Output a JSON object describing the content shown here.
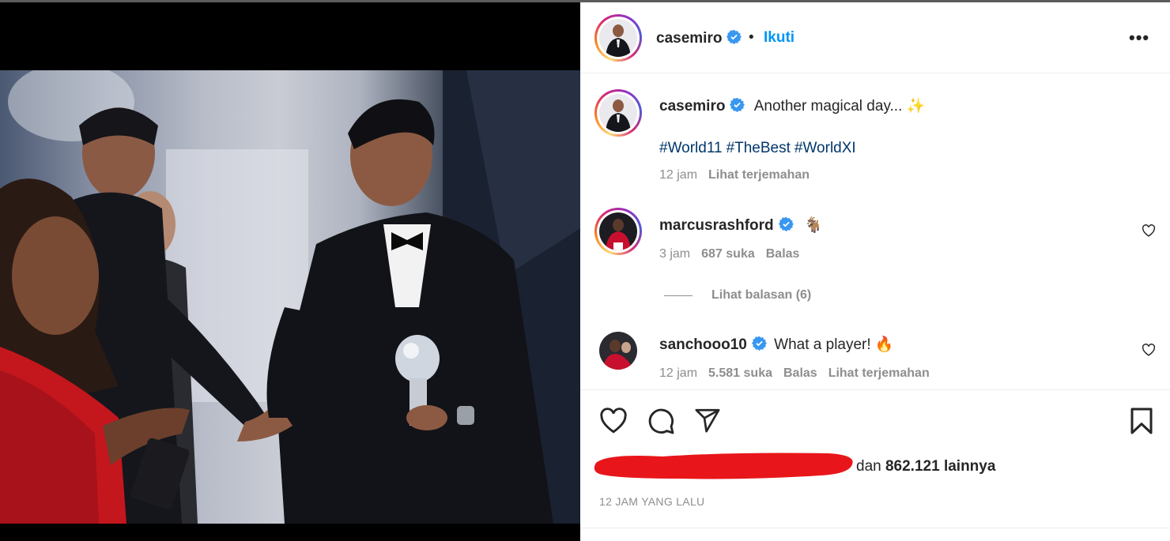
{
  "post": {
    "author": "casemiro",
    "follow_label": "Ikuti",
    "separator": "•",
    "more_label": "•••",
    "caption_text": "Another magical day... ✨",
    "hashtags": [
      "#World11",
      "#TheBest",
      "#WorldXI"
    ],
    "caption_time": "12 jam",
    "see_translation": "Lihat terjemahan"
  },
  "comments": [
    {
      "user": "marcusrashford",
      "text": "🐐",
      "time": "3 jam",
      "likes": "687 suka",
      "reply_label": "Balas",
      "view_replies": "Lihat balasan (6)"
    },
    {
      "user": "sanchooo10",
      "text": "What a player! 🔥",
      "time": "12 jam",
      "likes": "5.581 suka",
      "reply_label": "Balas",
      "translate_label": "Lihat terjemahan"
    }
  ],
  "likes_summary": {
    "prefix": "dan ",
    "count": "862.121 lainnya"
  },
  "post_time": "12 JAM YANG LALU",
  "colors": {
    "link_blue": "#0095f6",
    "hashtag_blue": "#00376b",
    "verified_blue": "#3897f0",
    "muted_gray": "#8e8e8e",
    "text_dark": "#262626",
    "redaction_red": "#e8161b"
  },
  "icons": {
    "like": "heart-icon",
    "comment": "comment-icon",
    "share": "send-icon",
    "save": "bookmark-icon",
    "verified": "verified-badge-icon"
  }
}
